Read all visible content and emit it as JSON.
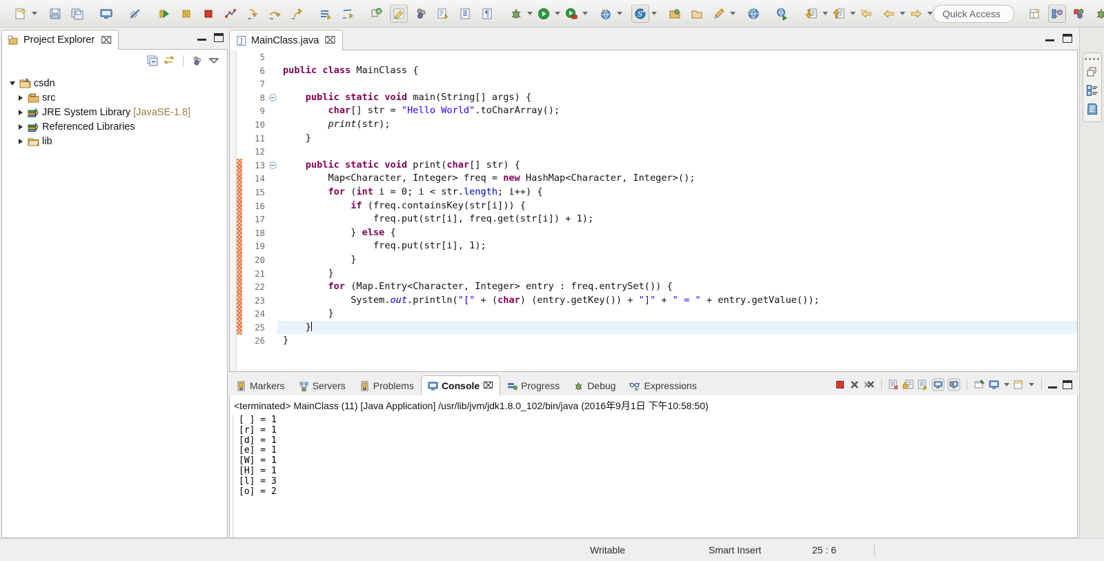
{
  "toolbar": {
    "groups": [
      {
        "items": [
          {
            "name": "new-wizard-icon",
            "label": "New"
          },
          {
            "name": "new-dropdown-arrow",
            "label": "New menu"
          }
        ]
      },
      {
        "items": [
          {
            "name": "save-icon",
            "label": "Save"
          },
          {
            "name": "save-all-icon",
            "label": "Save All"
          }
        ]
      },
      {
        "items": [
          {
            "name": "console-open-icon",
            "label": "Open Console"
          }
        ]
      },
      {
        "items": [
          {
            "name": "skip-breakpoints-icon",
            "label": "Skip All Breakpoints"
          }
        ]
      },
      {
        "items": [
          {
            "name": "resume-icon",
            "label": "Resume"
          },
          {
            "name": "suspend-icon",
            "label": "Suspend"
          },
          {
            "name": "terminate-icon",
            "label": "Terminate"
          },
          {
            "name": "disconnect-icon",
            "label": "Disconnect"
          },
          {
            "name": "step-into-icon",
            "label": "Step Into"
          },
          {
            "name": "step-over-icon",
            "label": "Step Over"
          },
          {
            "name": "step-return-icon",
            "label": "Step Return"
          }
        ]
      },
      {
        "items": [
          {
            "name": "new-java-package-icon",
            "label": "New Java Package"
          },
          {
            "name": "new-java-class-icon",
            "label": "New Java Class"
          }
        ]
      },
      {
        "items": [
          {
            "name": "toggle-mark-occurrences-icon",
            "label": "Toggle Mark Occurrences"
          },
          {
            "name": "highlight-icon",
            "label": "Toggle Highlight"
          },
          {
            "name": "toggle-block-selection-icon",
            "label": "Toggle Block Selection"
          },
          {
            "name": "next-annotation-icon",
            "label": "Next Annotation"
          },
          {
            "name": "show-whitespace-icon",
            "label": "Show Whitespace Characters"
          },
          {
            "name": "toggle-word-wrap-icon",
            "label": "Toggle Word Wrap"
          }
        ]
      },
      {
        "items": [
          {
            "name": "debug-icon",
            "label": "Debug"
          },
          {
            "name": "debug-dropdown-arrow",
            "label": "Debug menu"
          },
          {
            "name": "run-icon",
            "label": "Run"
          },
          {
            "name": "run-dropdown-arrow",
            "label": "Run menu"
          },
          {
            "name": "run-external-tools-icon",
            "label": "External Tools"
          },
          {
            "name": "external-tools-dropdown-arrow",
            "label": "External Tools menu"
          }
        ]
      },
      {
        "items": [
          {
            "name": "open-web-browser-icon",
            "label": "Open Web Browser"
          },
          {
            "name": "web-browser-dropdown-arrow",
            "label": "Web Browser menu"
          }
        ]
      },
      {
        "items": [
          {
            "name": "search-icon",
            "label": "Search"
          },
          {
            "name": "search-dropdown-arrow",
            "label": "Search menu"
          }
        ]
      },
      {
        "items": [
          {
            "name": "open-type-icon",
            "label": "Open Type"
          },
          {
            "name": "open-task-icon",
            "label": "Open Task"
          },
          {
            "name": "new-annotation-icon",
            "label": "New Annotation"
          },
          {
            "name": "annotation-dropdown-arrow",
            "label": "Annotation menu"
          }
        ]
      },
      {
        "items": [
          {
            "name": "open-perspective-globe-icon",
            "label": "Open Perspective"
          }
        ]
      },
      {
        "items": [
          {
            "name": "search-web-icon",
            "label": "Search Web"
          }
        ]
      },
      {
        "items": [
          {
            "name": "previous-edit-location-icon",
            "label": "Previous Edit Location"
          },
          {
            "name": "previous-dropdown-arrow",
            "label": "Previous menu"
          },
          {
            "name": "next-edit-location-icon",
            "label": "Next Edit Location"
          },
          {
            "name": "next-dropdown-arrow",
            "label": "Next menu"
          },
          {
            "name": "back-history-icon",
            "label": "Back"
          },
          {
            "name": "back-dropdown-arrow",
            "label": "Back menu"
          },
          {
            "name": "forward-history-icon",
            "label": "Forward"
          },
          {
            "name": "forward-dropdown-arrow",
            "label": "Forward menu"
          }
        ]
      }
    ],
    "quick_access": "Quick Access",
    "perspectives": [
      {
        "name": "open-perspective-button",
        "label": "Open Perspective"
      },
      {
        "name": "perspective-java-ee",
        "label": "Java EE"
      },
      {
        "name": "perspective-java",
        "label": "Java"
      },
      {
        "name": "perspective-debug",
        "label": "Debug"
      }
    ]
  },
  "project_explorer": {
    "tab_label": "Project Explorer",
    "close_glyph": "⌧",
    "toolbar": [
      {
        "name": "collapse-all-icon",
        "label": "Collapse All"
      },
      {
        "name": "link-with-editor-icon",
        "label": "Link with Editor"
      },
      {
        "name": "focus-on-active-task-icon",
        "label": "Focus on Active Task"
      },
      {
        "name": "view-menu-icon",
        "label": "View Menu"
      }
    ],
    "minimize_label": "Minimize",
    "maximize_label": "Maximize",
    "tree": [
      {
        "label": "csdn",
        "suffix": "",
        "icon": "project-folder-icon",
        "expanded": true,
        "depth": 0
      },
      {
        "label": "src",
        "suffix": "",
        "icon": "source-folder-icon",
        "expanded": false,
        "depth": 1
      },
      {
        "label": "JRE System Library ",
        "suffix": "[JavaSE-1.8]",
        "icon": "library-icon",
        "expanded": false,
        "depth": 1
      },
      {
        "label": "Referenced Libraries",
        "suffix": "",
        "icon": "library-icon",
        "expanded": false,
        "depth": 1
      },
      {
        "label": "lib",
        "suffix": "",
        "icon": "folder-icon",
        "expanded": false,
        "depth": 1
      }
    ]
  },
  "editor": {
    "tab_label": "MainClass.java",
    "close_glyph": "⌧",
    "file_icon": "java-file-icon",
    "minimize_label": "Minimize",
    "maximize_label": "Maximize",
    "first_line_number": 5,
    "current_line": 25,
    "change_bar_from": 13,
    "change_bar_to": 25,
    "fold_lines": [
      8,
      13
    ],
    "lines": [
      {
        "n": 5,
        "tokens": []
      },
      {
        "n": 6,
        "tokens": [
          {
            "t": "kw",
            "v": "public class"
          },
          {
            "t": "p",
            "v": " MainClass {"
          }
        ]
      },
      {
        "n": 7,
        "tokens": []
      },
      {
        "n": 8,
        "tokens": [
          {
            "t": "p",
            "v": "    "
          },
          {
            "t": "kw",
            "v": "public static void"
          },
          {
            "t": "p",
            "v": " main(String[] args) {"
          }
        ]
      },
      {
        "n": 9,
        "tokens": [
          {
            "t": "p",
            "v": "        "
          },
          {
            "t": "kw",
            "v": "char"
          },
          {
            "t": "p",
            "v": "[] str = "
          },
          {
            "t": "str",
            "v": "\"Hello World\""
          },
          {
            "t": "p",
            "v": ".toCharArray();"
          }
        ]
      },
      {
        "n": 10,
        "tokens": [
          {
            "t": "p",
            "v": "        "
          },
          {
            "t": "mth",
            "v": "print"
          },
          {
            "t": "p",
            "v": "(str);"
          }
        ]
      },
      {
        "n": 11,
        "tokens": [
          {
            "t": "p",
            "v": "    }"
          }
        ]
      },
      {
        "n": 12,
        "tokens": []
      },
      {
        "n": 13,
        "tokens": [
          {
            "t": "p",
            "v": "    "
          },
          {
            "t": "kw",
            "v": "public static void"
          },
          {
            "t": "p",
            "v": " print("
          },
          {
            "t": "kw",
            "v": "char"
          },
          {
            "t": "p",
            "v": "[] str) {"
          }
        ]
      },
      {
        "n": 14,
        "tokens": [
          {
            "t": "p",
            "v": "        Map<Character, Integer> freq = "
          },
          {
            "t": "kw",
            "v": "new"
          },
          {
            "t": "p",
            "v": " HashMap<Character, Integer>();"
          }
        ]
      },
      {
        "n": 15,
        "tokens": [
          {
            "t": "p",
            "v": "        "
          },
          {
            "t": "kw",
            "v": "for"
          },
          {
            "t": "p",
            "v": " ("
          },
          {
            "t": "kw",
            "v": "int"
          },
          {
            "t": "p",
            "v": " i = "
          },
          {
            "t": "num",
            "v": "0"
          },
          {
            "t": "p",
            "v": "; i < str."
          },
          {
            "t": "fld",
            "v": "length"
          },
          {
            "t": "p",
            "v": "; i++) {"
          }
        ]
      },
      {
        "n": 16,
        "tokens": [
          {
            "t": "p",
            "v": "            "
          },
          {
            "t": "kw",
            "v": "if"
          },
          {
            "t": "p",
            "v": " (freq.containsKey(str[i])) {"
          }
        ]
      },
      {
        "n": 17,
        "tokens": [
          {
            "t": "p",
            "v": "                freq.put(str[i], freq.get(str[i]) + "
          },
          {
            "t": "num",
            "v": "1"
          },
          {
            "t": "p",
            "v": ");"
          }
        ]
      },
      {
        "n": 18,
        "tokens": [
          {
            "t": "p",
            "v": "            } "
          },
          {
            "t": "kw",
            "v": "else"
          },
          {
            "t": "p",
            "v": " {"
          }
        ]
      },
      {
        "n": 19,
        "tokens": [
          {
            "t": "p",
            "v": "                freq.put(str[i], "
          },
          {
            "t": "num",
            "v": "1"
          },
          {
            "t": "p",
            "v": ");"
          }
        ]
      },
      {
        "n": 20,
        "tokens": [
          {
            "t": "p",
            "v": "            }"
          }
        ]
      },
      {
        "n": 21,
        "tokens": [
          {
            "t": "p",
            "v": "        }"
          }
        ]
      },
      {
        "n": 22,
        "tokens": [
          {
            "t": "p",
            "v": "        "
          },
          {
            "t": "kw",
            "v": "for"
          },
          {
            "t": "p",
            "v": " (Map.Entry<Character, Integer> entry : freq.entrySet()) {"
          }
        ]
      },
      {
        "n": 23,
        "tokens": [
          {
            "t": "p",
            "v": "            System."
          },
          {
            "t": "fldi",
            "v": "out"
          },
          {
            "t": "p",
            "v": ".println("
          },
          {
            "t": "str",
            "v": "\"[\""
          },
          {
            "t": "p",
            "v": " + ("
          },
          {
            "t": "kw",
            "v": "char"
          },
          {
            "t": "p",
            "v": ") (entry.getKey()) + "
          },
          {
            "t": "str",
            "v": "\"]\""
          },
          {
            "t": "p",
            "v": " + "
          },
          {
            "t": "str",
            "v": "\" = \""
          },
          {
            "t": "p",
            "v": " + entry.getValue());"
          }
        ]
      },
      {
        "n": 24,
        "tokens": [
          {
            "t": "p",
            "v": "        }"
          }
        ]
      },
      {
        "n": 25,
        "tokens": [
          {
            "t": "p",
            "v": "    }"
          },
          {
            "t": "caret",
            "v": ""
          }
        ]
      },
      {
        "n": 26,
        "tokens": [
          {
            "t": "p",
            "v": "}"
          }
        ]
      }
    ]
  },
  "bottom_panel": {
    "tabs": [
      {
        "label": "Markers",
        "icon": "markers-icon",
        "active": false
      },
      {
        "label": "Servers",
        "icon": "servers-icon",
        "active": false
      },
      {
        "label": "Problems",
        "icon": "problems-icon",
        "active": false
      },
      {
        "label": "Console",
        "icon": "console-icon",
        "active": true
      },
      {
        "label": "Progress",
        "icon": "progress-icon",
        "active": false
      },
      {
        "label": "Debug",
        "icon": "debug-bug-icon",
        "active": false
      },
      {
        "label": "Expressions",
        "icon": "expressions-icon",
        "active": false
      }
    ],
    "close_glyph": "⌧",
    "toolbar": [
      {
        "name": "terminate-icon",
        "label": "Terminate"
      },
      {
        "name": "remove-launch-icon",
        "label": "Remove Launch"
      },
      {
        "name": "remove-all-terminated-icon",
        "label": "Remove All Terminated Launches"
      },
      {
        "name": "clear-console-icon",
        "label": "Clear Console"
      },
      {
        "name": "scroll-lock-icon",
        "label": "Scroll Lock"
      },
      {
        "name": "word-wrap-icon",
        "label": "Word Wrap"
      },
      {
        "name": "show-console-on-output-icon",
        "label": "Show Console When Standard Out Changes"
      },
      {
        "name": "show-console-on-error-icon",
        "label": "Show Console When Standard Error Changes"
      },
      {
        "name": "pin-console-icon",
        "label": "Pin Console"
      },
      {
        "name": "display-selected-console-icon",
        "label": "Display Selected Console"
      },
      {
        "name": "display-console-dropdown-arrow",
        "label": "Display Console menu"
      },
      {
        "name": "open-console-icon",
        "label": "Open Console"
      },
      {
        "name": "open-console-dropdown-arrow",
        "label": "Open Console menu"
      },
      {
        "name": "minimize-icon",
        "label": "Minimize"
      },
      {
        "name": "maximize-icon",
        "label": "Maximize"
      }
    ],
    "console": {
      "header": "<terminated> MainClass (11) [Java Application] /usr/lib/jvm/jdk1.8.0_102/bin/java (2016年9月1日 下午10:58:50)",
      "output": "[ ] = 1\n[r] = 1\n[d] = 1\n[e] = 1\n[W] = 1\n[H] = 1\n[l] = 3\n[o] = 2"
    }
  },
  "right_bar": {
    "items": [
      {
        "name": "restore-icon",
        "label": "Restore"
      },
      {
        "name": "outline-view-icon",
        "label": "Outline"
      },
      {
        "name": "task-list-view-icon",
        "label": "Task List"
      }
    ]
  },
  "status_bar": {
    "writable": "Writable",
    "insert_mode": "Smart Insert",
    "position": "25 : 6"
  },
  "colors": {
    "keyword": "#7f0055",
    "string": "#2a00ff",
    "field": "#0000c0",
    "current_line": "#eaf2fb",
    "change_bar": "#e8804f",
    "chrome": "#efefef"
  }
}
